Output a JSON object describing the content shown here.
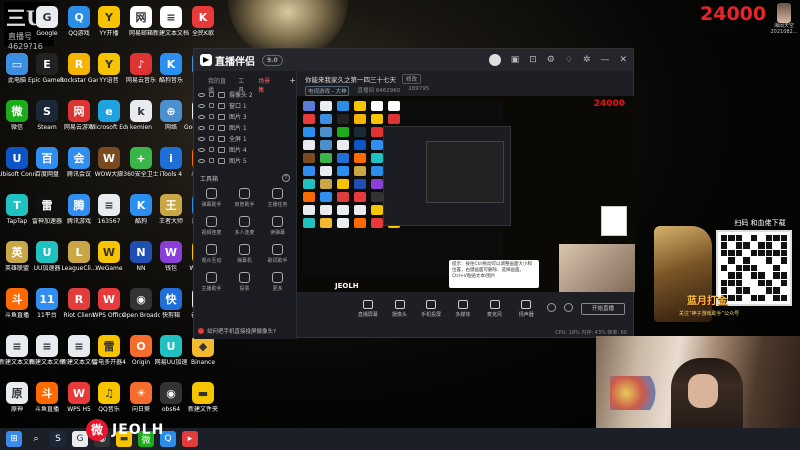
{
  "desktop": {
    "logo": {
      "line1": "三U",
      "line2": "直播号",
      "line3": "4629?16"
    },
    "icons": [
      {
        "label": "Admin",
        "color": "#5a7bd6",
        "glyph": "A"
      },
      {
        "label": "Google",
        "color": "#e8ebef",
        "glyph": "G"
      },
      {
        "label": "QQ游戏",
        "color": "#2a8ee8",
        "glyph": "Q"
      },
      {
        "label": "YY开播",
        "color": "#f7c400",
        "glyph": "Y"
      },
      {
        "label": "网易邮箱",
        "color": "#ffffff",
        "glyph": "网"
      },
      {
        "label": "新建文本文档",
        "color": "#ffffff",
        "glyph": "≡"
      },
      {
        "label": "全民K歌",
        "color": "#e83a3a",
        "glyph": "K"
      },
      {
        "label": "此电脑",
        "color": "#3c8fe0",
        "glyph": "▭"
      },
      {
        "label": "Epic Games Launcher",
        "color": "#222222",
        "glyph": "E"
      },
      {
        "label": "Rockstar Games...",
        "color": "#f4b400",
        "glyph": "R"
      },
      {
        "label": "YY语音",
        "color": "#f7c400",
        "glyph": "Y"
      },
      {
        "label": "网易云音乐",
        "color": "#d33",
        "glyph": "♪"
      },
      {
        "label": "酷狗音乐",
        "color": "#2b8ff0",
        "glyph": "K"
      },
      {
        "label": "回收站",
        "color": "#4c8fcf",
        "glyph": "♻"
      },
      {
        "label": "微信",
        "color": "#1aad19",
        "glyph": "微"
      },
      {
        "label": "Steam",
        "color": "#1b2838",
        "glyph": "S"
      },
      {
        "label": "网易云游戏",
        "color": "#d33",
        "glyph": "网"
      },
      {
        "label": "Microsoft Edge",
        "color": "#1fa3e0",
        "glyph": "e"
      },
      {
        "label": "kemien",
        "color": "#e8ebef",
        "glyph": "k"
      },
      {
        "label": "网络",
        "color": "#4c8fcf",
        "glyph": "⊕"
      },
      {
        "label": "Google Chrome",
        "color": "#e8ebef",
        "glyph": "G"
      },
      {
        "label": "Ubisoft Connect",
        "color": "#0d54c4",
        "glyph": "U"
      },
      {
        "label": "百度网盘",
        "color": "#2f8ef0",
        "glyph": "百"
      },
      {
        "label": "腾讯会议",
        "color": "#2f8ef0",
        "glyph": "会"
      },
      {
        "label": "WOW大脚",
        "color": "#7a4a20",
        "glyph": "W"
      },
      {
        "label": "360安全卫士",
        "color": "#3bb54a",
        "glyph": "+"
      },
      {
        "label": "iTools 4",
        "color": "#1f6fd6",
        "glyph": "i"
      },
      {
        "label": "斗鱼直播",
        "color": "#ff6a00",
        "glyph": "斗"
      },
      {
        "label": "TapTap",
        "color": "#1fc1c1",
        "glyph": "T"
      },
      {
        "label": "雷神加速器",
        "color": "#111111",
        "glyph": "雷"
      },
      {
        "label": "腾讯游戏",
        "color": "#2f8ef0",
        "glyph": "腾"
      },
      {
        "label": "163567",
        "color": "#e8ebef",
        "glyph": "≡"
      },
      {
        "label": "酷狗",
        "color": "#2b8ff0",
        "glyph": "K"
      },
      {
        "label": "王者大师",
        "color": "#c9a646",
        "glyph": "王"
      },
      {
        "label": "腾讯QQ",
        "color": "#2a8ee8",
        "glyph": "Q"
      },
      {
        "label": "英雄联盟",
        "color": "#c9a646",
        "glyph": "英"
      },
      {
        "label": "UU加速器",
        "color": "#1fc1c1",
        "glyph": "U"
      },
      {
        "label": "LeagueCli...",
        "color": "#c9a646",
        "glyph": "L"
      },
      {
        "label": "WeGame",
        "color": "#f7c400",
        "glyph": "W"
      },
      {
        "label": "NN",
        "color": "#1f4fb3",
        "glyph": "N"
      },
      {
        "label": "钱包",
        "color": "#8a3fd6",
        "glyph": "W"
      },
      {
        "label": "WeGame",
        "color": "#f7c400",
        "glyph": "W"
      },
      {
        "label": "斗鱼直播",
        "color": "#ff6a00",
        "glyph": "斗"
      },
      {
        "label": "11平台",
        "color": "#2f8ef0",
        "glyph": "11"
      },
      {
        "label": "Riot Client",
        "color": "#e23d3d",
        "glyph": "R"
      },
      {
        "label": "WPS Office",
        "color": "#e83a3a",
        "glyph": "W"
      },
      {
        "label": "Open Broadcast...",
        "color": "#333333",
        "glyph": "◉"
      },
      {
        "label": "快剪辑",
        "color": "#1f6fd6",
        "glyph": "快"
      },
      {
        "label": "谷歌驿站",
        "color": "#e8ebef",
        "glyph": "谷"
      },
      {
        "label": "新建文本文档",
        "color": "#e8ebef",
        "glyph": "≡"
      },
      {
        "label": "新建文本文档",
        "color": "#e8ebef",
        "glyph": "≡"
      },
      {
        "label": "新建文本文档",
        "color": "#e8ebef",
        "glyph": "≡"
      },
      {
        "label": "雷电多开器4",
        "color": "#f7c400",
        "glyph": "雷"
      },
      {
        "label": "Origin",
        "color": "#f56c2d",
        "glyph": "O"
      },
      {
        "label": "网易UU加速",
        "color": "#1fc1c1",
        "glyph": "U"
      },
      {
        "label": "Binance",
        "color": "#f3ba2f",
        "glyph": "◆"
      },
      {
        "label": "原神",
        "color": "#e8ebef",
        "glyph": "原"
      },
      {
        "label": "斗鱼直播",
        "color": "#ff6a00",
        "glyph": "斗"
      },
      {
        "label": "WPS H5",
        "color": "#e83a3a",
        "glyph": "W"
      },
      {
        "label": "QQ音乐",
        "color": "#f7c400",
        "glyph": "♫"
      },
      {
        "label": "向日葵",
        "color": "#f56c2d",
        "glyph": "☀"
      },
      {
        "label": "obs64",
        "color": "#333333",
        "glyph": "◉"
      },
      {
        "label": "新建文件夹",
        "color": "#f7c400",
        "glyph": "▬"
      },
      {
        "label": "新建图片 20211120",
        "color": "#e8ebef",
        "glyph": "▨"
      }
    ]
  },
  "taskbar": {
    "icons": [
      {
        "name": "windows-start-icon",
        "glyph": "⊞",
        "color": "#3b8be8"
      },
      {
        "name": "search-icon",
        "glyph": "⌕",
        "color": "#1c1f27"
      },
      {
        "name": "steam-icon",
        "glyph": "S",
        "color": "#1b2838"
      },
      {
        "name": "chrome-icon",
        "glyph": "G",
        "color": "#e8ebef"
      },
      {
        "name": "obs-icon",
        "glyph": "◉",
        "color": "#333"
      },
      {
        "name": "folder-icon",
        "glyph": "▬",
        "color": "#f7c400"
      },
      {
        "name": "wechat-icon",
        "glyph": "微",
        "color": "#1aad19"
      },
      {
        "name": "qq-icon",
        "glyph": "Q",
        "color": "#2a8ee8"
      },
      {
        "name": "broadcast-icon",
        "glyph": "▸",
        "color": "#e23d3d"
      }
    ]
  },
  "watermark": {
    "text": "JEOLH"
  },
  "app": {
    "name": "直播伴侣",
    "version": "9.0",
    "tabs": [
      "我的直播",
      "工具",
      "场景集"
    ],
    "active_tab": 2,
    "scenes": [
      {
        "label": "摄像头 2"
      },
      {
        "label": "窗口 1"
      },
      {
        "label": "图片 3"
      },
      {
        "label": "图片 1"
      },
      {
        "label": "全屏 1"
      },
      {
        "label": "图片 4"
      },
      {
        "label": "图片 5"
      }
    ],
    "tools_title": "工具箱",
    "tools": [
      "弹幕助手",
      "房管助手",
      "主播任务",
      "视频连麦",
      "多人连麦",
      "读弹幕",
      "观众互动",
      "弹幕机",
      "歌词助手",
      "主播助手",
      "投票",
      "更多"
    ],
    "footer_tip": "如何把手机直接投屏摄像头?",
    "room": {
      "title": "你能来我家久之第一四三十七天",
      "edit": "修改",
      "category": "电视游戏 - 大神",
      "stat1": "直播间 6462960",
      "stat2": "289795"
    },
    "preview": {
      "count": "24000",
      "watermark": "JEOLH",
      "tooltip": "提示：按住Ctrl拖动可以调整画面大小和位置，右键画面可删除、选择画面。Ctrl+V粘贴文本/图片"
    },
    "toolbar": [
      "直播屏幕",
      "摄像头",
      "手机投屏",
      "多媒体",
      "麦克风",
      "扬声器"
    ],
    "start_label": "开始直播",
    "status": "CPU: 18%  内存: 43%  帧率: 60"
  },
  "overlay": {
    "counter": "24000",
    "streamer_name": "海阔天空",
    "streamer_date": "2021082...",
    "promo_title": "扫码 和血佬下载",
    "promo_brand": "蓝月打金",
    "promo_sub": "关注“神子游戏助手”公众号"
  }
}
